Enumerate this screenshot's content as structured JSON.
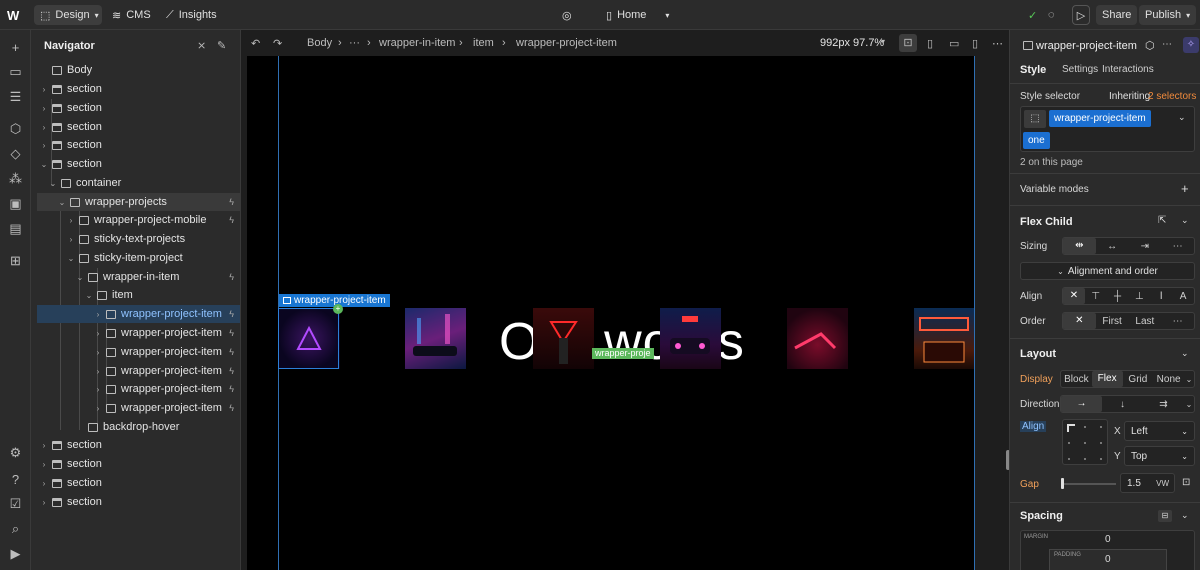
{
  "topbar": {
    "logo": "W",
    "design_label": "Design",
    "cms_label": "CMS",
    "insights_label": "Insights",
    "page_label": "Home",
    "share_label": "Share",
    "publish_label": "Publish"
  },
  "navigator": {
    "title": "Navigator",
    "items": [
      {
        "label": "Body"
      },
      {
        "label": "section"
      },
      {
        "label": "section"
      },
      {
        "label": "section"
      },
      {
        "label": "section"
      },
      {
        "label": "section"
      },
      {
        "label": "container"
      },
      {
        "label": "wrapper-projects"
      },
      {
        "label": "wrapper-project-mobile"
      },
      {
        "label": "sticky-text-projects"
      },
      {
        "label": "sticky-item-project"
      },
      {
        "label": "wrapper-in-item"
      },
      {
        "label": "item"
      },
      {
        "label": "wrapper-project-item"
      },
      {
        "label": "wrapper-project-item"
      },
      {
        "label": "wrapper-project-item"
      },
      {
        "label": "wrapper-project-item"
      },
      {
        "label": "wrapper-project-item"
      },
      {
        "label": "wrapper-project-item"
      },
      {
        "label": "backdrop-hover"
      },
      {
        "label": "section"
      },
      {
        "label": "section"
      },
      {
        "label": "section"
      },
      {
        "label": "section"
      }
    ]
  },
  "breadcrumb": {
    "body": "Body",
    "ellipsis": "···",
    "wrapper_in_item": "wrapper-in-item",
    "item": "item",
    "wrapper_project_item": "wrapper-project-item",
    "viewport": "992px 97.7%"
  },
  "canvas": {
    "heading": "Our works",
    "selected_tag": "wrapper-project-item",
    "green_tag": "wrapper-proje"
  },
  "panel": {
    "element_name": "wrapper-project-item",
    "tabs": [
      "Style",
      "Settings",
      "Interactions"
    ],
    "style_selector_label": "Style selector",
    "inheriting_label": "Inheriting",
    "inheriting_count": "2 selectors",
    "selector_chip": "wrapper-project-item",
    "combo_chip": "one",
    "on_page": "2 on this page",
    "variable_modes": "Variable modes",
    "flex_child_heading": "Flex Child",
    "sizing_label": "Sizing",
    "align_order_label": "Alignment and order",
    "align_label": "Align",
    "order_label": "Order",
    "order_first": "First",
    "order_last": "Last",
    "layout_heading": "Layout",
    "display_label": "Display",
    "display_options": [
      "Block",
      "Flex",
      "Grid",
      "None"
    ],
    "direction_label": "Direction",
    "layout_align_label": "Align",
    "x_label": "X",
    "x_value": "Left",
    "y_label": "Y",
    "y_value": "Top",
    "gap_label": "Gap",
    "gap_value": "1.5",
    "gap_unit": "VW",
    "spacing_heading": "Spacing",
    "margin_label": "MARGIN",
    "margin_value": "0",
    "padding_label": "PADDING",
    "padding_value": "0"
  },
  "colors": {
    "accent": "#1b6fd1",
    "inheriting": "#f08a3c",
    "display_label": "#f0a05a",
    "check": "#57c957"
  }
}
